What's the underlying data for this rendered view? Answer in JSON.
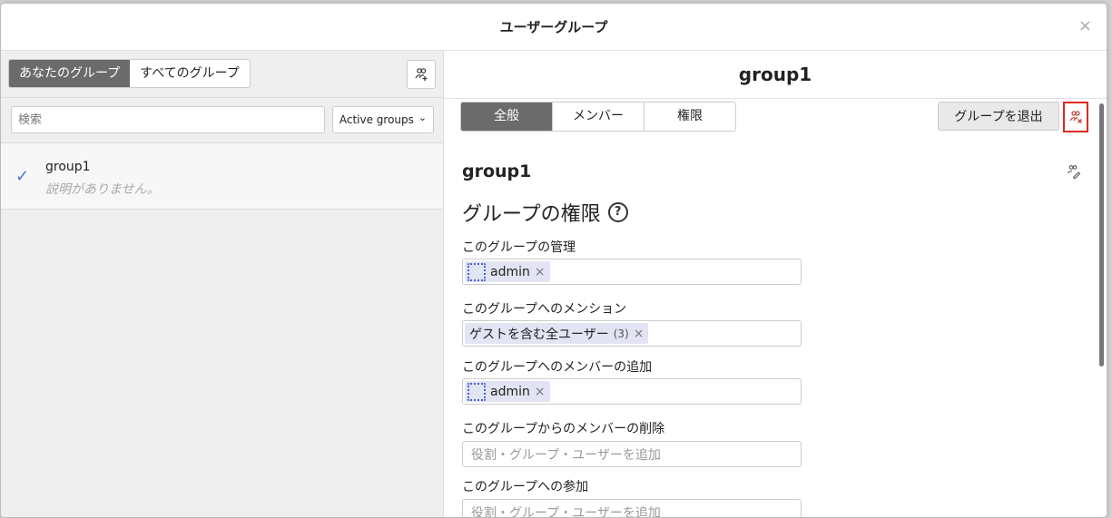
{
  "modal": {
    "title": "ユーザーグループ",
    "close_glyph": "×"
  },
  "left": {
    "scope_tabs": [
      {
        "label": "あなたのグループ",
        "active": true
      },
      {
        "label": "すべてのグループ",
        "active": false
      }
    ],
    "new_group_icon": "user-group-add-icon",
    "search": {
      "placeholder": "検索",
      "value": ""
    },
    "filter": {
      "label": "Active groups",
      "chevron": "⌄"
    },
    "groups": [
      {
        "name": "group1",
        "description": "説明がありません。",
        "selected": true
      }
    ]
  },
  "right": {
    "title": "group1",
    "tabs": [
      {
        "label": "全般",
        "active": true
      },
      {
        "label": "メンバー",
        "active": false
      },
      {
        "label": "権限",
        "active": false
      }
    ],
    "leave_button": "グループを退出",
    "remove_icon": "user-group-remove-icon",
    "section_title": "group1",
    "edit_icon": "edit-group-icon",
    "permissions_title": "グループの権限",
    "help_glyph": "?",
    "permissions": [
      {
        "label": "このグループの管理",
        "chips": [
          {
            "text": "admin",
            "count": "",
            "role": true
          }
        ],
        "placeholder": ""
      },
      {
        "label": "このグループへのメンション",
        "chips": [
          {
            "text": "ゲストを含む全ユーザー",
            "count": "(3)",
            "role": false
          }
        ],
        "placeholder": ""
      },
      {
        "label": "このグループへのメンバーの追加",
        "chips": [
          {
            "text": "admin",
            "count": "",
            "role": true
          }
        ],
        "placeholder": ""
      },
      {
        "label": "このグループからのメンバーの削除",
        "chips": [],
        "placeholder": "役割・グループ・ユーザーを追加"
      },
      {
        "label": "このグループへの参加",
        "chips": [],
        "placeholder": "役割・グループ・ユーザーを追加"
      }
    ]
  },
  "colors": {
    "accent": "#4a6ee0",
    "active_tab": "#6b6b6b",
    "chip_bg": "#e2e4f3",
    "highlight": "#e0261f"
  }
}
